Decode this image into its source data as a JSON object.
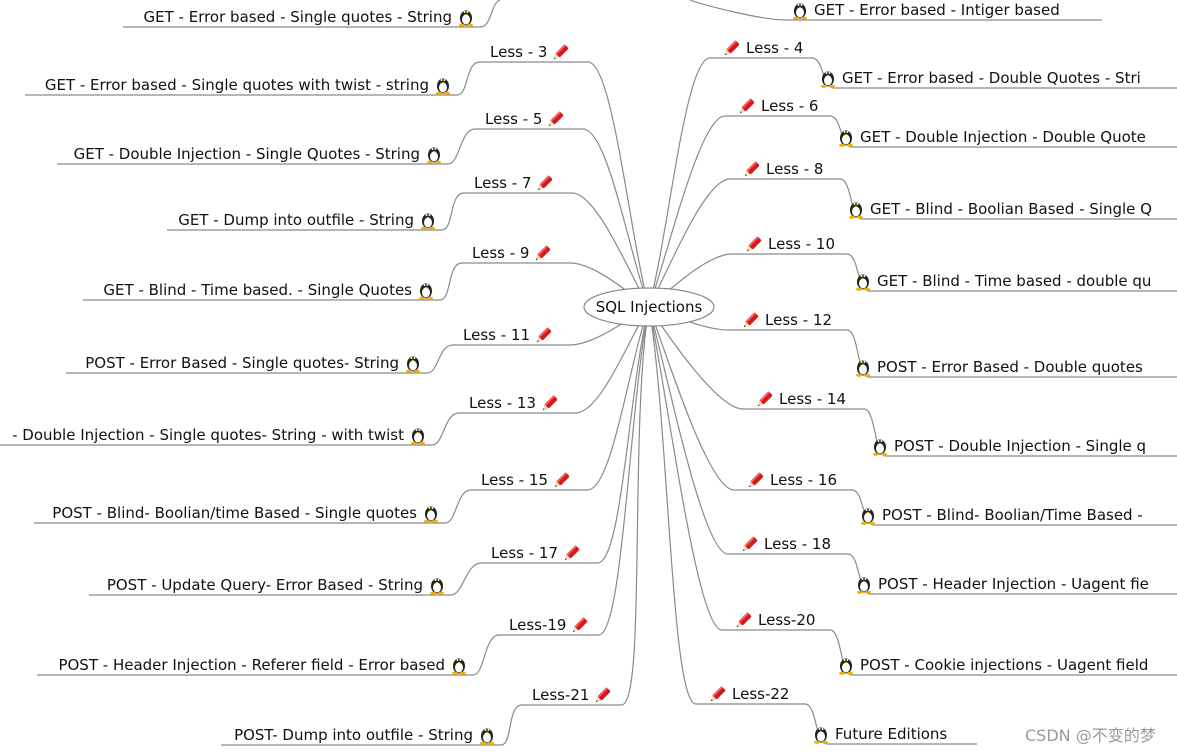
{
  "center": {
    "label": "SQL Injections"
  },
  "colors": {
    "line": "#8a8a8a",
    "pencil": "#d81818",
    "text": "#111111"
  },
  "icons": {
    "lesson": "pencil-icon",
    "leaf": "penguin-icon"
  },
  "left_branches": [
    {
      "less": "",
      "leaf": "GET - Error based - Single quotes - String"
    },
    {
      "less": "Less - 3",
      "leaf": "GET - Error based - Single quotes with twist - string"
    },
    {
      "less": "Less - 5",
      "leaf": "GET - Double Injection - Single Quotes - String"
    },
    {
      "less": "Less - 7",
      "leaf": "GET - Dump into outfile - String"
    },
    {
      "less": "Less - 9",
      "leaf": "GET - Blind - Time based. -  Single Quotes"
    },
    {
      "less": "Less - 11",
      "leaf": "POST - Error Based - Single quotes- String"
    },
    {
      "less": "Less - 13",
      "leaf": "- Double Injection - Single quotes- String - with twist"
    },
    {
      "less": "Less - 15",
      "leaf": "POST - Blind- Boolian/time Based - Single quotes"
    },
    {
      "less": "Less - 17",
      "leaf": "POST - Update Query- Error Based - String"
    },
    {
      "less": "Less-19",
      "leaf": "POST - Header Injection - Referer field - Error based"
    },
    {
      "less": "Less-21",
      "leaf": "POST- Dump into outfile - String"
    }
  ],
  "right_branches": [
    {
      "less": "",
      "leaf": "GET - Error based - Intiger based"
    },
    {
      "less": "Less - 4",
      "leaf": "GET - Error based - Double Quotes - Stri"
    },
    {
      "less": "Less - 6",
      "leaf": "GET - Double Injection - Double Quote"
    },
    {
      "less": "Less - 8",
      "leaf": "GET - Blind - Boolian Based - Single Q"
    },
    {
      "less": "Less - 10",
      "leaf": "GET - Blind - Time based - double qu"
    },
    {
      "less": "Less - 12",
      "leaf": "POST - Error Based - Double quotes"
    },
    {
      "less": "Less - 14",
      "leaf": "POST - Double Injection - Single q"
    },
    {
      "less": "Less - 16",
      "leaf": "POST - Blind- Boolian/Time Based -"
    },
    {
      "less": "Less - 18",
      "leaf": "POST - Header Injection - Uagent fie"
    },
    {
      "less": "Less-20",
      "leaf": "POST - Cookie injections - Uagent field"
    },
    {
      "less": "Less-22",
      "leaf": "Future Editions"
    }
  ],
  "watermark": "CSDN @不变的梦"
}
